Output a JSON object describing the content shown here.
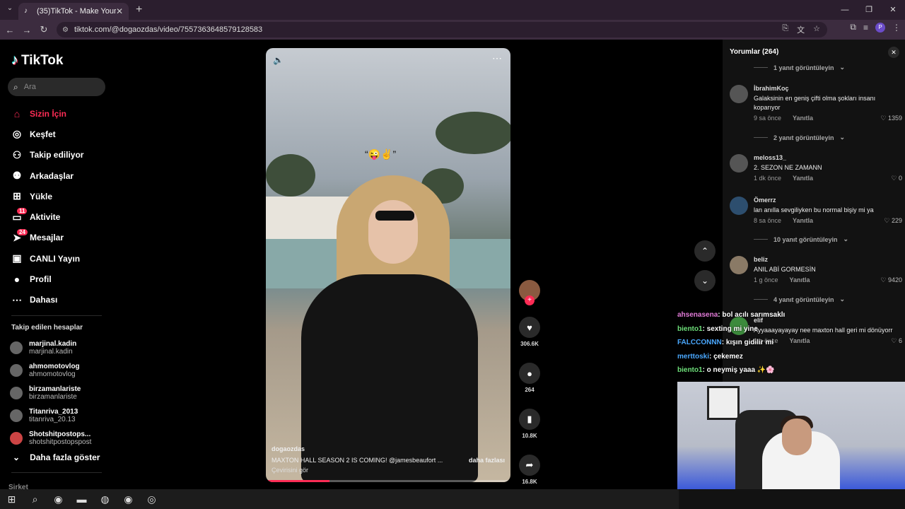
{
  "browser": {
    "tab_title": "(35)TikTok - Make Your Day",
    "new_tab": "+",
    "url": "tiktok.com/@dogaozdas/video/7557363648579128583",
    "profile_letter": "P"
  },
  "sidebar": {
    "logo": "TikTok",
    "search_placeholder": "Ara",
    "nav": [
      {
        "label": "Sizin İçin",
        "icon": "home-icon"
      },
      {
        "label": "Keşfet",
        "icon": "compass-icon"
      },
      {
        "label": "Takip ediliyor",
        "icon": "following-icon"
      },
      {
        "label": "Arkadaşlar",
        "icon": "friends-icon"
      },
      {
        "label": "Yükle",
        "icon": "upload-icon"
      },
      {
        "label": "Aktivite",
        "icon": "inbox-icon",
        "badge": "11"
      },
      {
        "label": "Mesajlar",
        "icon": "messages-icon",
        "badge": "24"
      },
      {
        "label": "CANLI Yayın",
        "icon": "live-icon"
      },
      {
        "label": "Profil",
        "icon": "profile-icon"
      },
      {
        "label": "Dahası",
        "icon": "more-icon"
      }
    ],
    "followed_title": "Takip edilen hesaplar",
    "accounts": [
      {
        "name": "marjinal.kadin",
        "handle": "marjinal.kadin"
      },
      {
        "name": "ahmomotovlog",
        "handle": "ahmomotovlog"
      },
      {
        "name": "birzamanlariste",
        "handle": "birzamanlariste"
      },
      {
        "name": "Titanriva_2013",
        "handle": "titanriva_20.13"
      },
      {
        "name": "Shotshitpostops...",
        "handle": "shotshitpostopspost"
      }
    ],
    "show_more": "Daha fazla göster",
    "company": "Şirket"
  },
  "video": {
    "caption_emoji": "“😜✌️”",
    "author": "dogaozdas",
    "description": "MAXTON HALL SEASON 2 IS COMING! @jamesbeaufort ...",
    "more": "daha fazlası",
    "translate": "Çevirisini gör",
    "progress": 0.26
  },
  "actions": {
    "likes": "306.6K",
    "comments": "264",
    "saves": "10.8K",
    "shares": "16.8K"
  },
  "comments": {
    "title": "Yorumlar (264)",
    "view_replies_1": "1 yanıt görüntüleyin",
    "view_replies_2": "2 yanıt görüntüleyin",
    "view_replies_10": "10 yanıt görüntüleyin",
    "view_replies_4": "4 yanıt görüntüleyin",
    "reply_label": "Yanıtla",
    "items": [
      {
        "user": "İbrahimKoç",
        "text": "Galaksinin en geniş çifti olma şokları insanı koparıyor",
        "time": "9 sa önce",
        "likes": "1359"
      },
      {
        "user": "meloss13_",
        "text": "2. SEZON NE ZAMANN",
        "time": "1 dk önce",
        "likes": "0"
      },
      {
        "user": "Ömerrz",
        "text": "lan anılla sevgiliyken bu normal bişiy mi ya",
        "time": "8 sa önce",
        "likes": "229"
      },
      {
        "user": "beliz",
        "text": "ANIL ABİ GORMESİN",
        "time": "1 g önce",
        "likes": "9420"
      },
      {
        "user": "elif",
        "text": "Ayyaaayayayay nee maxton hall geri mi dönüyorr",
        "time": "1 g önce",
        "likes": "6"
      }
    ]
  },
  "chat": [
    {
      "user": "ahsenasena",
      "msg": ": bol acılı sarımsaklı",
      "color": "#e27bd8"
    },
    {
      "user": "biento1",
      "msg": ": sexting mi yine",
      "color": "#6ee07a"
    },
    {
      "user": "FALCCONNN",
      "msg": ": kışın gidilir mi",
      "color": "#4aa8ff"
    },
    {
      "user": "merttoski",
      "msg": ": çekemez",
      "color": "#4aa8ff"
    },
    {
      "user": "biento1",
      "msg": ": o neymiş yaaa ✨🌸",
      "color": "#6ee07a"
    }
  ],
  "colors": {
    "accent": "#fe2c55",
    "bg": "#000000",
    "panel": "#121212"
  }
}
